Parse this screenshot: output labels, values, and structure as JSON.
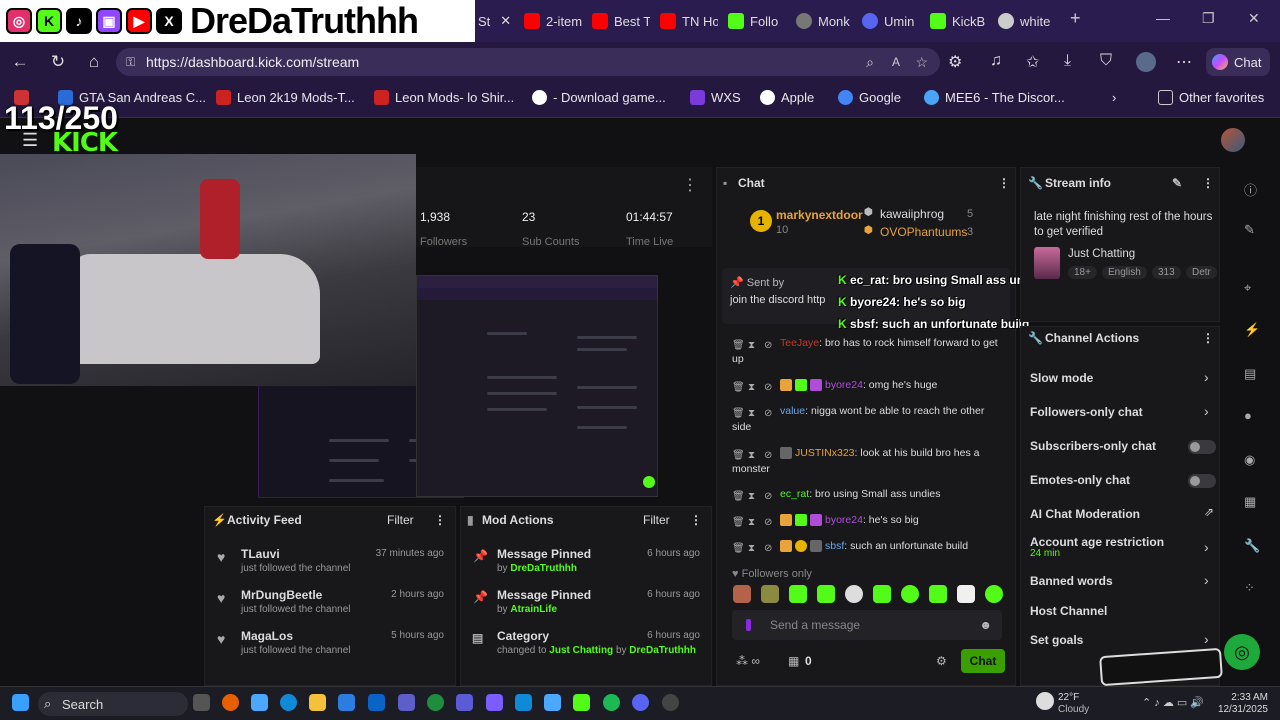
{
  "browser": {
    "tabs": [
      {
        "label": "St",
        "icon": "kick-icon",
        "color": "#53fc18",
        "active": true
      },
      {
        "label": "2-item",
        "icon": "youtube-icon",
        "color": "#ff0000"
      },
      {
        "label": "Best T",
        "icon": "youtube-icon",
        "color": "#ff0000"
      },
      {
        "label": "TN Ho",
        "icon": "youtube-icon",
        "color": "#ff0000"
      },
      {
        "label": "Follo",
        "icon": "kick-icon",
        "color": "#53fc18"
      },
      {
        "label": "Monk",
        "icon": "monkey-icon",
        "color": "#777"
      },
      {
        "label": "Umin",
        "icon": "discord-icon",
        "color": "#5865f2"
      },
      {
        "label": "KickB",
        "icon": "kick-icon",
        "color": "#53fc18"
      },
      {
        "label": "white",
        "icon": "google-icon",
        "color": "#cccccc"
      }
    ],
    "url": "https://dashboard.kick.com/stream",
    "copilot_label": "Chat",
    "bookmarks": [
      {
        "label": "GTA San Andreas C...",
        "color": "#2a6bd8"
      },
      {
        "label": "Leon 2k19 Mods-T...",
        "color": "#cc2222"
      },
      {
        "label": "Leon Mods- lo Shir...",
        "color": "#cc2222"
      },
      {
        "label": "- Download game...",
        "color": "#ffffff"
      },
      {
        "label": "WXS",
        "color": "#7a3bd8"
      },
      {
        "label": "Apple",
        "color": "#ffffff"
      },
      {
        "label": "Google",
        "color": "#4285f4"
      },
      {
        "label": "MEE6 - The Discor...",
        "color": "#49a6f7"
      }
    ],
    "other_favorites": "Other favorites"
  },
  "overlay": {
    "handle": "DreDaTruthhh",
    "goal": "113/250",
    "chat_lines": [
      {
        "user": "ec_rat",
        "text": ": bro using Small ass undies",
        "color": "#ffffff"
      },
      {
        "user": "byore24",
        "text": ": he's so big",
        "color": "#ffffff"
      },
      {
        "user": "sbsf",
        "text": ": such an unfortunate build",
        "color": "#ffffff"
      }
    ]
  },
  "dashboard": {
    "stats": [
      {
        "value": "1,938",
        "label": "Followers"
      },
      {
        "value": "23",
        "label": "Sub Counts"
      },
      {
        "value": "01:44:57",
        "label": "Time Live"
      }
    ],
    "activity_feed": {
      "title": "Activity Feed",
      "filter": "Filter",
      "items": [
        {
          "name": "TLauvi",
          "sub": "just followed the channel",
          "time": "37 minutes ago"
        },
        {
          "name": "MrDungBeetle",
          "sub": "just followed the channel",
          "time": "2 hours ago"
        },
        {
          "name": "MagaLos",
          "sub": "just followed the channel",
          "time": "5 hours ago"
        }
      ]
    },
    "mod_actions": {
      "title": "Mod Actions",
      "filter": "Filter",
      "items": [
        {
          "title": "Message Pinned",
          "prefix": "by",
          "user": "DreDaTruthhh",
          "time": "6 hours ago"
        },
        {
          "title": "Message Pinned",
          "prefix": "by",
          "user": "AtrainLife",
          "time": "6 hours ago"
        },
        {
          "title": "Category",
          "prefix": "changed to",
          "user": "Just Chatting",
          "suffix": "by",
          "user2": "DreDaTruthhh",
          "time": "6 hours ago"
        }
      ]
    },
    "chat": {
      "title": "Chat",
      "top_gifter": {
        "name": "markynextdoor",
        "count": "10"
      },
      "leaders": [
        {
          "name": "kawaiiphrog",
          "count": "5"
        },
        {
          "name": "OVOPhantuums",
          "count": "3"
        }
      ],
      "pinned": {
        "sent_by": "Sent by",
        "text": "join the discord http"
      },
      "messages": [
        {
          "user": "TeeJaye",
          "text": "bro has to rock himself forward to get up",
          "color": "#c0392b"
        },
        {
          "user": "byore24",
          "text": "omg he's huge",
          "color": "#b04dd8"
        },
        {
          "user": "value",
          "text": "nigga wont be able to reach the other side",
          "color": "#6aa7e8"
        },
        {
          "user": "JUSTINx323",
          "text": "look at his build bro hes a monster",
          "color": "#e8a33a"
        },
        {
          "user": "ec_rat",
          "text": "bro using Small ass undies",
          "color": "#53fc18"
        },
        {
          "user": "byore24",
          "text": "he's so big",
          "color": "#b04dd8"
        },
        {
          "user": "sbsf",
          "text": "such an unfortunate build",
          "color": "#6aa7e8"
        }
      ],
      "followers_only": "Followers only",
      "placeholder": "Send a message",
      "send": "Chat",
      "count": "0"
    },
    "stream_info": {
      "title": "Stream info",
      "stream_title": "late night finishing rest of the hours to get verified",
      "category": "Just Chatting",
      "tags": [
        "18+",
        "English",
        "313",
        "Detr"
      ]
    },
    "channel_actions": {
      "title": "Channel Actions",
      "items": [
        {
          "label": "Slow mode",
          "control": "chevron"
        },
        {
          "label": "Followers-only chat",
          "control": "chevron"
        },
        {
          "label": "Subscribers-only chat",
          "control": "toggle"
        },
        {
          "label": "Emotes-only chat",
          "control": "toggle"
        },
        {
          "label": "AI Chat Moderation",
          "control": "external"
        },
        {
          "label": "Account age restriction",
          "sub": "24 min",
          "control": "chevron"
        },
        {
          "label": "Banned words",
          "control": "chevron"
        },
        {
          "label": "Host Channel",
          "control": "none"
        },
        {
          "label": "Set goals",
          "control": "chevron"
        }
      ]
    }
  },
  "taskbar": {
    "search": "Search",
    "weather_temp": "22°F",
    "weather_desc": "Cloudy",
    "time": "2:33 AM",
    "date": "12/31/2025"
  },
  "colors": {
    "kick_green": "#53fc18",
    "browser_purple": "#2a1c4f"
  }
}
